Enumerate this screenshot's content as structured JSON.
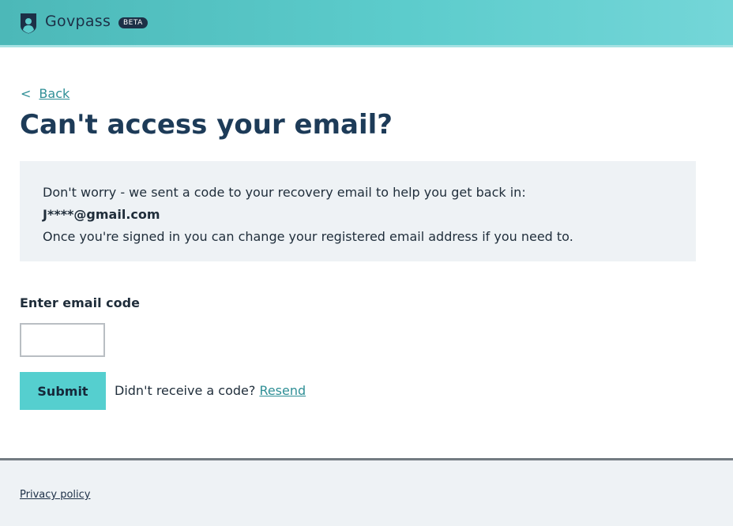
{
  "header": {
    "brand": "Govpass",
    "badge": "BETA",
    "logo_icon": "shield-person-icon"
  },
  "nav": {
    "back_chevron": "<",
    "back_label": "Back"
  },
  "page": {
    "title": "Can't access your email?"
  },
  "notice": {
    "line1": "Don't worry - we sent a code to your recovery email to help you get back in:",
    "email": "J****@gmail.com",
    "line2": "Once you're signed in you can change your registered email address if you need to."
  },
  "form": {
    "code_label": "Enter email code",
    "code_value": "",
    "submit_label": "Submit",
    "resend_prompt": "Didn't receive a code?",
    "resend_link": "Resend"
  },
  "footer": {
    "privacy_link": "Privacy policy"
  },
  "colors": {
    "header_teal": "#5ccccc",
    "navy": "#1d3b58",
    "link_teal": "#2f8f96",
    "button_teal": "#55cfcf",
    "panel_grey": "#eef2f5"
  }
}
